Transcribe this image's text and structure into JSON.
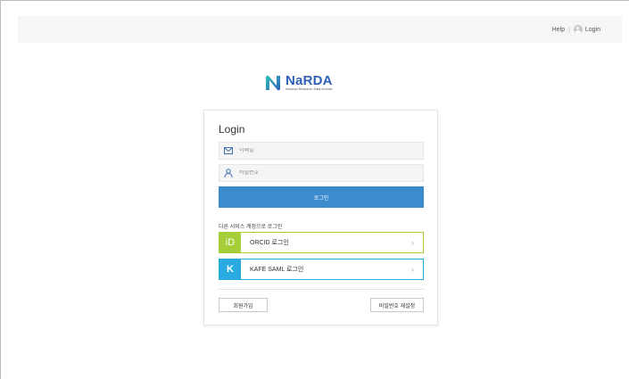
{
  "topbar": {
    "help_label": "Help",
    "separator": "|",
    "login_label": "Login",
    "login_icon": "user-circle-icon"
  },
  "logo": {
    "name": "NaRDA",
    "subtitle": "National Research Data Archive",
    "colors": {
      "mark_start": "#2ec4b6",
      "mark_end": "#2f5fb8",
      "text": "#2f5fb8"
    }
  },
  "login_card": {
    "title": "Login",
    "email": {
      "placeholder": "이메일",
      "value": "",
      "icon": "envelope-icon"
    },
    "password": {
      "placeholder": "비밀번호",
      "value": "",
      "icon": "user-icon"
    },
    "submit_label": "로그인",
    "other_services_label": "다른 서비스 계정으로 로그인",
    "orcid": {
      "badge": "iD",
      "label": "ORCID 로그인",
      "color": "#a6ce39"
    },
    "kafe": {
      "badge": "K",
      "label": "KAFE SAML 로그인",
      "color": "#29abe2"
    },
    "signup_label": "회원가입",
    "reset_password_label": "비밀번호 재설정",
    "accent_color": "#3d8bcf"
  }
}
